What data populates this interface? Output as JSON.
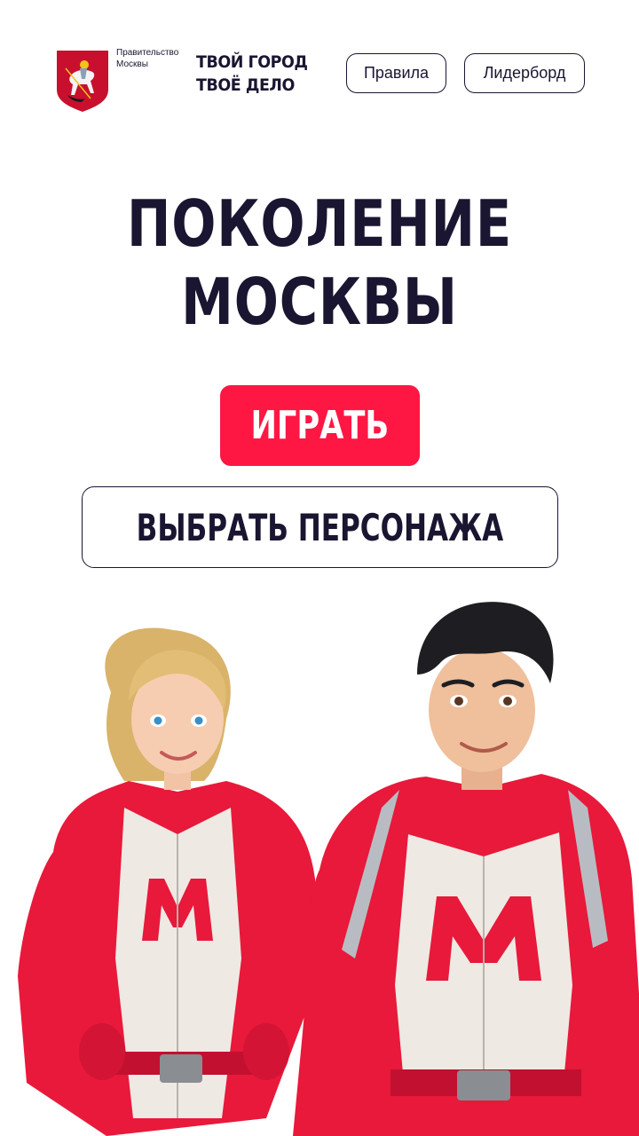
{
  "header": {
    "gov_label": "Правительство Москвы",
    "slogan_line1": "ТВОЙ ГОРОД",
    "slogan_line2": "ТВОЁ ДЕЛО",
    "nav": {
      "rules": "Правила",
      "leaderboard": "Лидерборд"
    }
  },
  "hero": {
    "title_line1": "ПОКОЛЕНИЕ",
    "title_line2": "МОСКВЫ",
    "play_label": "ИГРАТЬ",
    "choose_character_label": "ВЫБРАТЬ ПЕРСОНАЖА"
  },
  "colors": {
    "accent": "#ff1744",
    "text": "#1a1530",
    "background": "#ffffff"
  }
}
